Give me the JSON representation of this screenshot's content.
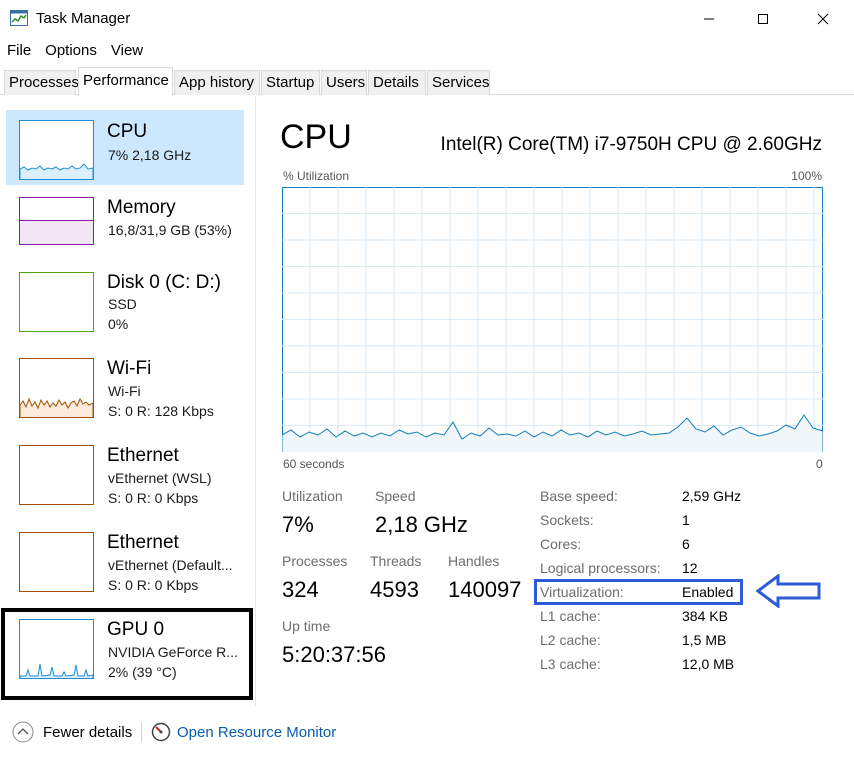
{
  "window": {
    "title": "Task Manager",
    "icon": "task-manager-icon"
  },
  "menu": [
    "File",
    "Options",
    "View"
  ],
  "tabs": [
    {
      "label": "Processes"
    },
    {
      "label": "Performance",
      "active": true
    },
    {
      "label": "App history"
    },
    {
      "label": "Startup"
    },
    {
      "label": "Users"
    },
    {
      "label": "Details"
    },
    {
      "label": "Services"
    }
  ],
  "sidebar": {
    "items": [
      {
        "title": "CPU",
        "line1": "7%  2,18 GHz",
        "line2": "",
        "color": "#1c8fd4",
        "selected": true
      },
      {
        "title": "Memory",
        "line1": "16,8/31,9 GB (53%)",
        "line2": "",
        "color": "#8b1aa3",
        "usage_fraction": 0.53
      },
      {
        "title": "Disk 0 (C: D:)",
        "line1": "SSD",
        "line2": "0%",
        "color": "#4da60c"
      },
      {
        "title": "Wi-Fi",
        "line1": "Wi-Fi",
        "line2": "S: 0  R: 128 Kbps",
        "color": "#a74f01"
      },
      {
        "title": "Ethernet",
        "line1": "vEthernet (WSL)",
        "line2": "S: 0  R: 0 Kbps",
        "color": "#a74f01"
      },
      {
        "title": "Ethernet",
        "line1": "vEthernet (Default...",
        "line2": "S: 0  R: 0 Kbps",
        "color": "#a74f01"
      },
      {
        "title": "GPU 0",
        "line1": "NVIDIA GeForce R...",
        "line2": "2%  (39 °C)",
        "color": "#1c8fd4"
      }
    ]
  },
  "main": {
    "heading": "CPU",
    "model": "Intel(R) Core(TM) i7-9750H CPU @ 2.60GHz",
    "util_label": "% Utilization",
    "util_max": "100%",
    "graph_left": "60 seconds",
    "graph_right": "0",
    "graph_color": "#117dbb",
    "stats": {
      "utilization_label": "Utilization",
      "utilization": "7%",
      "speed_label": "Speed",
      "speed": "2,18 GHz",
      "processes_label": "Processes",
      "processes": "324",
      "threads_label": "Threads",
      "threads": "4593",
      "handles_label": "Handles",
      "handles": "140097",
      "uptime_label": "Up time",
      "uptime": "5:20:37:56"
    },
    "specs": [
      {
        "label": "Base speed:",
        "value": "2,59 GHz"
      },
      {
        "label": "Sockets:",
        "value": "1"
      },
      {
        "label": "Cores:",
        "value": "6"
      },
      {
        "label": "Logical processors:",
        "value": "12"
      },
      {
        "label": "Virtualization:",
        "value": "Enabled"
      },
      {
        "label": "L1 cache:",
        "value": "384 KB"
      },
      {
        "label": "L2 cache:",
        "value": "1,5 MB"
      },
      {
        "label": "L3 cache:",
        "value": "12,0 MB"
      }
    ],
    "highlight_color": "#2b5bd7"
  },
  "footer": {
    "fewer_details": "Fewer details",
    "resource_monitor": "Open Resource Monitor"
  }
}
